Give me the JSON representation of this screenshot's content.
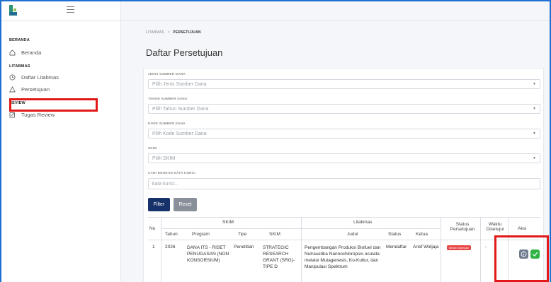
{
  "sidebar": {
    "sections": [
      {
        "title": "BERANDA",
        "items": [
          {
            "label": "Beranda",
            "icon": "home-icon"
          }
        ]
      },
      {
        "title": "LITABMAS",
        "items": [
          {
            "label": "Daftar Litabmas",
            "icon": "clock-icon"
          },
          {
            "label": "Persetujuan",
            "icon": "triangle-icon"
          }
        ]
      },
      {
        "title": "REVIEW",
        "items": [
          {
            "label": "Tugas Review",
            "icon": "edit-icon"
          }
        ]
      }
    ]
  },
  "breadcrumb": {
    "parent": "LITABMAS",
    "separator": ">",
    "current": "PERSETUJUAN"
  },
  "page": {
    "title": "Daftar Persetujuan"
  },
  "filters": {
    "jenis": {
      "label": "JENIS SUMBER DANA",
      "placeholder": "Pilih Jenis Sumber Dana"
    },
    "tahun": {
      "label": "TAHUN SUMBER DANA",
      "placeholder": "Pilih Tahun Sumber Dana"
    },
    "kode": {
      "label": "KODE SUMBER DANA",
      "placeholder": "Pilih Kode Sumber Dana"
    },
    "skim": {
      "label": "SKIM",
      "placeholder": "Pilih SKIM"
    },
    "keyword": {
      "label": "CARI DENGAN KATA KUNCI",
      "placeholder": "kata kunci..."
    },
    "filter_label": "Filter",
    "reset_label": "Reset"
  },
  "table": {
    "group_headers": {
      "no": "No",
      "skim": "SKIM",
      "litabmas": "Litabmas",
      "status_persetujuan": "Status Persetujuan",
      "waktu": "Waktu Disetujui",
      "aksi": "Aksi"
    },
    "sub_headers": {
      "tahun": "Tahun",
      "program": "Program",
      "tipe": "Tipe",
      "skim": "SKIM",
      "judul": "Judul",
      "status": "Status",
      "ketua": "Ketua"
    },
    "rows": [
      {
        "no": "1",
        "tahun": "2026",
        "program": "DANA ITS - RISET PENUGASAN (NON KONSORSIUM)",
        "tipe": "Penelitian",
        "skim": "STRATEGIC RESEARCH GRANT (SRG)-TIPE D",
        "judul": "Pengembangan Produksi Biofuel dan Nutrasetika Nannochloropsis oculata melalui Mutagenesis, Ko-Kultur, dan Manipulasi Spektrum",
        "status": "Mendaftar",
        "ketua": "Arief Widjaja",
        "status_persetujuan": "Belum Disetujui",
        "waktu": "-"
      }
    ]
  },
  "colors": {
    "primary": "#17316b",
    "danger": "#e84545",
    "success": "#2fb344",
    "highlight": "#e21818"
  }
}
